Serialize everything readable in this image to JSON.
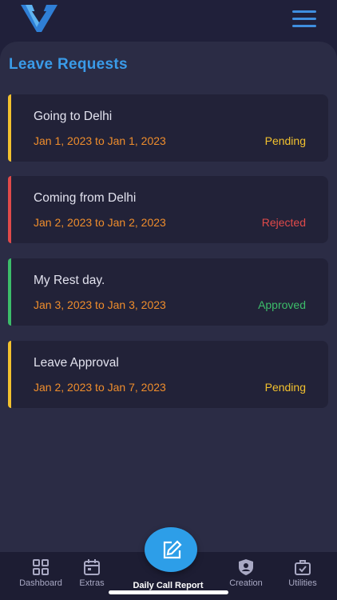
{
  "header": {
    "logo_icon": "v-logo-icon",
    "menu_icon": "hamburger-menu-icon"
  },
  "page": {
    "title": "Leave Requests"
  },
  "colors": {
    "accent": "#3a9be8",
    "date": "#ef8d2c",
    "pending": "#f2c12e",
    "rejected": "#e04a4a",
    "approved": "#3cbd6a"
  },
  "requests": [
    {
      "title": "Going to Delhi",
      "dates": "Jan 1, 2023 to Jan 1, 2023",
      "status": "Pending"
    },
    {
      "title": "Coming from Delhi",
      "dates": "Jan 2, 2023 to Jan 2, 2023",
      "status": "Rejected"
    },
    {
      "title": "My Rest day.",
      "dates": "Jan 3, 2023 to Jan 3, 2023",
      "status": "Approved"
    },
    {
      "title": "Leave Approval",
      "dates": "Jan 2, 2023 to Jan 7, 2023",
      "status": "Pending"
    }
  ],
  "nav": {
    "dashboard": "Dashboard",
    "extras": "Extras",
    "daily_call_report": "Daily Call Report",
    "creation": "Creation",
    "utilities": "Utilities"
  }
}
